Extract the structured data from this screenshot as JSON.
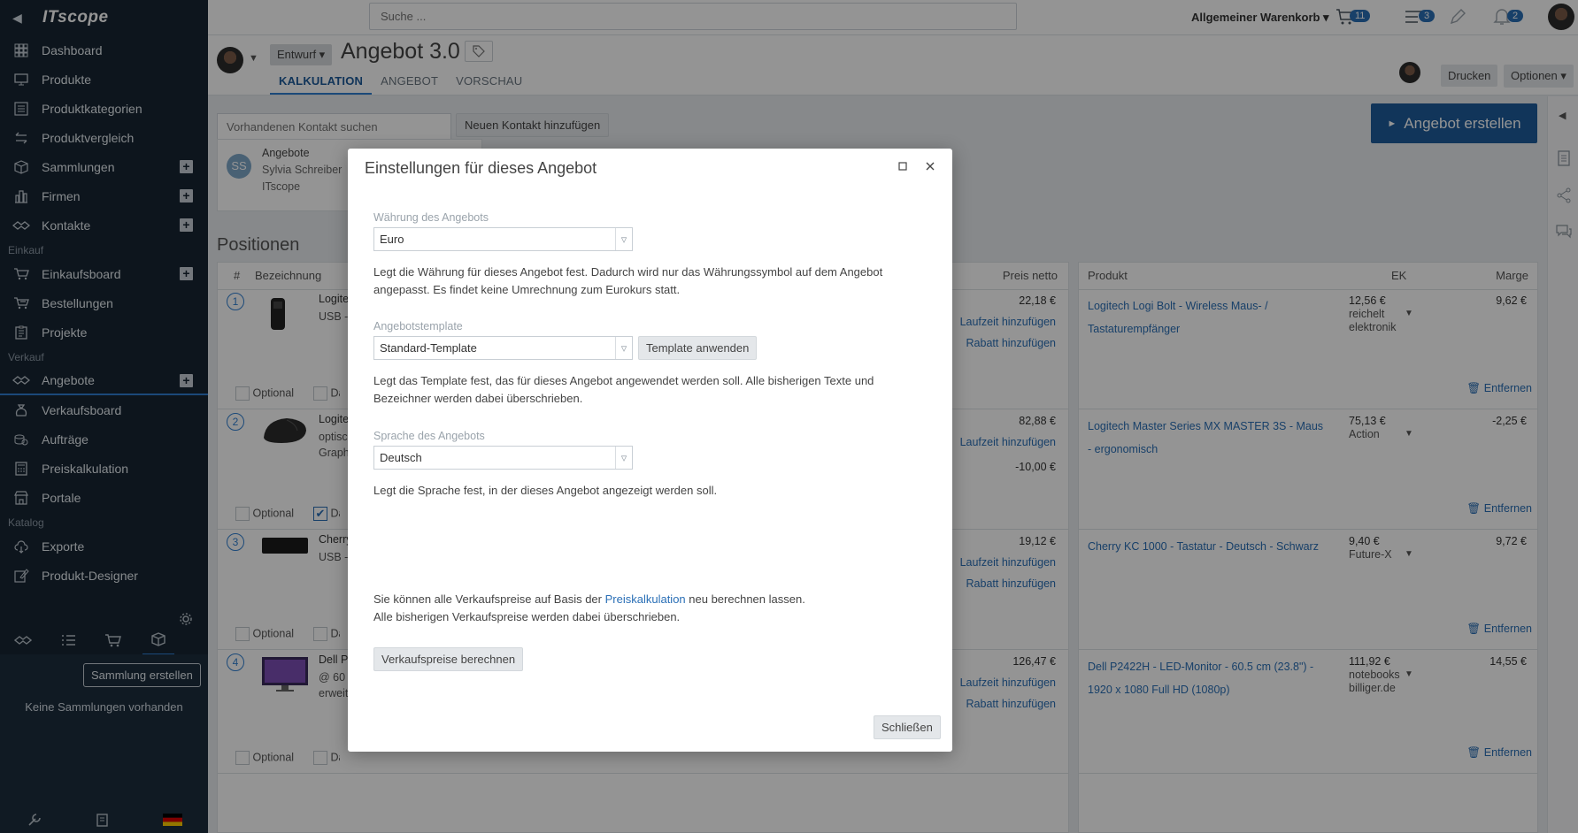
{
  "app": {
    "logo": "ITscope"
  },
  "sidebar": {
    "items_top": [
      {
        "label": "Dashboard",
        "icon": "grid-icon"
      },
      {
        "label": "Produkte",
        "icon": "monitor-icon"
      },
      {
        "label": "Produktkategorien",
        "icon": "list-icon"
      },
      {
        "label": "Produktvergleich",
        "icon": "compare-icon"
      },
      {
        "label": "Sammlungen",
        "icon": "box-icon",
        "plus": true
      },
      {
        "label": "Firmen",
        "icon": "building-icon",
        "plus": true
      },
      {
        "label": "Kontakte",
        "icon": "handshake-icon",
        "plus": true
      }
    ],
    "section_einkauf": "Einkauf",
    "items_einkauf": [
      {
        "label": "Einkaufsboard",
        "icon": "cart-icon",
        "plus": true
      },
      {
        "label": "Bestellungen",
        "icon": "cart-list-icon"
      },
      {
        "label": "Projekte",
        "icon": "clipboard-icon"
      }
    ],
    "section_verkauf": "Verkauf",
    "items_verkauf": [
      {
        "label": "Angebote",
        "icon": "handshake-icon",
        "plus": true,
        "active": true
      },
      {
        "label": "Verkaufsboard",
        "icon": "moneybag-icon"
      },
      {
        "label": "Aufträge",
        "icon": "coins-icon"
      },
      {
        "label": "Preiskalkulation",
        "icon": "calculator-icon"
      },
      {
        "label": "Portale",
        "icon": "storefront-icon"
      }
    ],
    "section_katalog": "Katalog",
    "items_katalog": [
      {
        "label": "Exporte",
        "icon": "cloud-export-icon"
      },
      {
        "label": "Produkt-Designer",
        "icon": "edit-icon"
      }
    ],
    "create_collection": "Sammlung erstellen",
    "no_collections": "Keine Sammlungen vorhanden"
  },
  "topbar": {
    "search_placeholder": "Suche ...",
    "cart_label": "Allgemeiner Warenkorb ▾",
    "cart_count": "11",
    "list_count": "3",
    "notif_count": "2"
  },
  "header": {
    "status": "Entwurf ▾",
    "title": "Angebot 3.0",
    "tabs": [
      "KALKULATION",
      "ANGEBOT",
      "VORSCHAU"
    ],
    "print": "Drucken",
    "options": "Optionen ▾"
  },
  "content": {
    "contact_search_placeholder": "Vorhandenen Kontakt suchen",
    "add_contact": "Neuen Kontakt hinzufügen",
    "create_offer": "Angebot erstellen",
    "card": {
      "initials": "SS",
      "label": "Angebote",
      "name": "Sylvia Schreiber",
      "company": "ITscope"
    },
    "positions_title": "Positionen",
    "headers": {
      "num": "#",
      "desc": "Bezeichnung",
      "price": "Preis netto",
      "product": "Produkt",
      "ek": "EK",
      "margin": "Marge"
    },
    "optional": "Optional",
    "datasheet": "Datenblatt anhängen",
    "add_term": "Laufzeit hinzufügen",
    "add_discount": "Rabatt hinzufügen",
    "remove": "Entfernen",
    "rows": [
      {
        "num": "1",
        "name": "Logite",
        "sub": "USB -",
        "price": "22,18 €",
        "product": "Logitech Logi Bolt - Wireless Maus- / Tastaturempfänger",
        "ek": "12,56 €",
        "supplier": "reichelt elektronik",
        "margin": "9,62 €"
      },
      {
        "num": "2",
        "name": "Logite",
        "sub": "optisc",
        "sub2": "Graph",
        "price": "82,88 €",
        "discount": "-10,00 €",
        "product": "Logitech Master Series MX MASTER 3S - Maus - ergonomisch",
        "ek": "75,13 €",
        "supplier": "Action",
        "margin": "-2,25 €"
      },
      {
        "num": "3",
        "name": "Cherry",
        "sub": "USB -",
        "price": "19,12 €",
        "product": "Cherry KC 1000 - Tastatur - Deutsch - Schwarz",
        "ek": "9,40 €",
        "supplier": "Future-X",
        "margin": "9,72 €"
      },
      {
        "num": "4",
        "name": "Dell P",
        "sub": "@ 60",
        "sub2": "erweiterter Austauschservice und beschränkte Hardware-Garantie",
        "price": "126,47 €",
        "product": "Dell P2422H - LED-Monitor - 60.5 cm (23.8\") - 1920 x 1080 Full HD (1080p)",
        "ek": "111,92 €",
        "supplier": "notebooks billiger.de",
        "margin": "14,55 €"
      }
    ]
  },
  "modal": {
    "title": "Einstellungen für dieses Angebot",
    "currency_label": "Währung des Angebots",
    "currency_value": "Euro",
    "currency_desc": "Legt die Währung für dieses Angebot fest. Dadurch wird nur das Währungssymbol auf dem Angebot angepasst. Es findet keine Umrechnung zum Eurokurs statt.",
    "template_label": "Angebotstemplate",
    "template_value": "Standard-Template",
    "apply_template": "Template anwenden",
    "template_desc": "Legt das Template fest, das für dieses Angebot angewendet werden soll. Alle bisherigen Texte und Bezeichner werden dabei überschrieben.",
    "language_label": "Sprache des Angebots",
    "language_value": "Deutsch",
    "language_desc": "Legt die Sprache fest, in der dieses Angebot angezeigt werden soll.",
    "recalc_pre": "Sie können alle Verkaufspreise auf Basis der ",
    "recalc_link": "Preiskalkulation",
    "recalc_post": " neu berechnen lassen.",
    "recalc_line2": "Alle bisherigen Verkaufspreise werden dabei überschrieben.",
    "recalc_button": "Verkaufspreise berechnen",
    "close_button": "Schließen"
  }
}
